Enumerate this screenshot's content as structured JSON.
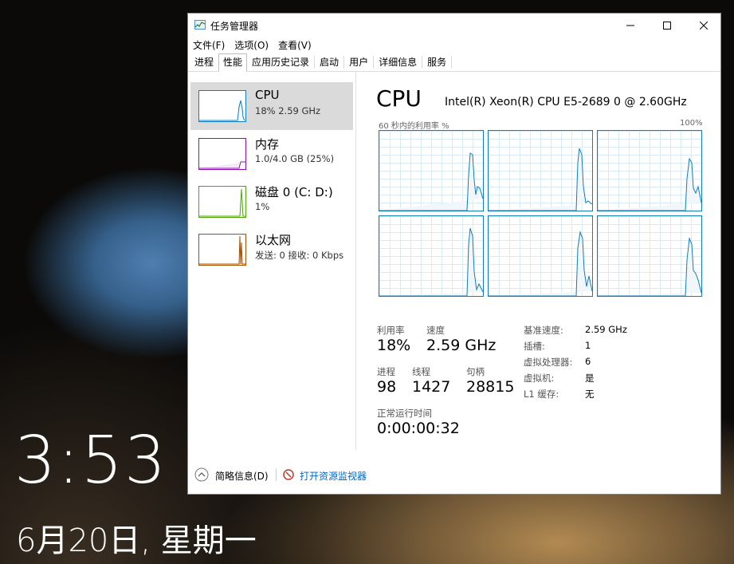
{
  "lockscreen": {
    "time": "3:53",
    "date": "6月20日, 星期一"
  },
  "window": {
    "title": "任务管理器",
    "controls": {
      "minimize": "—",
      "maximize": "☐",
      "close": "✕"
    }
  },
  "menu": [
    "文件(F)",
    "选项(O)",
    "查看(V)"
  ],
  "tabs": [
    "进程",
    "性能",
    "应用历史记录",
    "启动",
    "用户",
    "详细信息",
    "服务"
  ],
  "active_tab": "性能",
  "sidebar": {
    "items": [
      {
        "name": "CPU",
        "sub": "18% 2.59 GHz",
        "color": "#117dbb",
        "selected": true
      },
      {
        "name": "内存",
        "sub": "1.0/4.0 GB (25%)",
        "color": "#8b12ae",
        "selected": false
      },
      {
        "name": "磁盘 0 (C: D:)",
        "sub": "1%",
        "color": "#4da60c",
        "selected": false
      },
      {
        "name": "以太网",
        "sub": "发送: 0 接收: 0 Kbps",
        "color": "#a74f01",
        "selected": false
      }
    ]
  },
  "cpu_panel": {
    "title": "CPU",
    "model": "Intel(R) Xeon(R) CPU E5-2689 0 @ 2.60GHz",
    "graph_label": "60 秒内的利用率 %",
    "graph_max": "100%",
    "cores": 6,
    "stats": {
      "util_label": "利用率",
      "util_value": "18%",
      "speed_label": "速度",
      "speed_value": "2.59 GHz",
      "proc_label": "进程",
      "proc_value": "98",
      "thread_label": "线程",
      "thread_value": "1427",
      "handle_label": "句柄",
      "handle_value": "28815",
      "uptime_label": "正常运行时间",
      "uptime_value": "0:00:00:32"
    },
    "details": [
      {
        "key": "基准速度:",
        "value": "2.59 GHz"
      },
      {
        "key": "插槽:",
        "value": "1"
      },
      {
        "key": "虚拟处理器:",
        "value": "6"
      },
      {
        "key": "虚拟机:",
        "value": "是"
      },
      {
        "key": "L1 缓存:",
        "value": "无"
      }
    ]
  },
  "footer": {
    "brief": "简略信息(D)",
    "monitor": "打开资源监视器"
  },
  "colors": {
    "cpu_line": "#117dbb",
    "cpu_fill": "#f1f6fa",
    "link": "#0066cc"
  }
}
